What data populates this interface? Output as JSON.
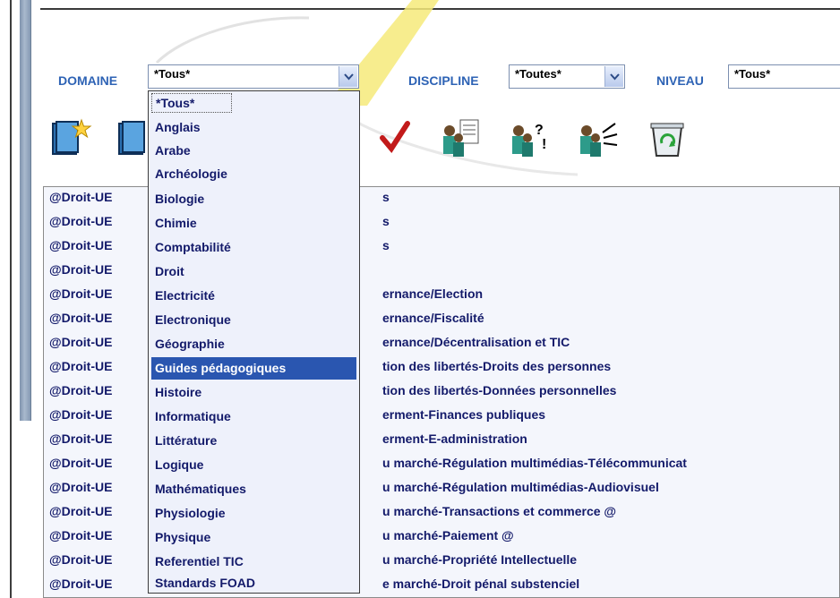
{
  "filters": {
    "domaine": {
      "label": "DOMAINE",
      "value": "*Tous*"
    },
    "discipline": {
      "label": "DISCIPLINE",
      "value": "*Toutes*"
    },
    "niveau": {
      "label": "NIVEAU",
      "value": "*Tous*"
    }
  },
  "toolbar": {
    "icons": [
      "new-star-book-icon",
      "book-icon",
      "checkmark-icon",
      "people-document-icon",
      "people-question-icon",
      "people-broadcast-icon",
      "recycle-bin-icon"
    ]
  },
  "dropdown": {
    "options": [
      "*Tous*",
      "Anglais",
      "Arabe",
      "Archéologie",
      "Biologie",
      "Chimie",
      "Comptabilité",
      "Droit",
      "Electricité",
      "Electronique",
      "Géographie",
      "Guides pédagogiques",
      "Histoire",
      "Informatique",
      "Littérature",
      "Logique",
      "Mathématiques",
      "Physiologie",
      "Physique",
      "Referentiel TIC",
      "Standards FOAD"
    ],
    "selected_index": 11
  },
  "table": {
    "rows": [
      {
        "left": "@Droit-UE",
        "right": "s"
      },
      {
        "left": "@Droit-UE",
        "right": "s"
      },
      {
        "left": "@Droit-UE",
        "right": "s"
      },
      {
        "left": "@Droit-UE",
        "right": ""
      },
      {
        "left": "@Droit-UE",
        "right": "ernance/Election"
      },
      {
        "left": "@Droit-UE",
        "right": "ernance/Fiscalité"
      },
      {
        "left": "@Droit-UE",
        "right": "ernance/Décentralisation et TIC"
      },
      {
        "left": "@Droit-UE",
        "right": "tion des libertés-Droits des personnes"
      },
      {
        "left": "@Droit-UE",
        "right": "tion des libertés-Données personnelles"
      },
      {
        "left": "@Droit-UE",
        "right": "erment-Finances publiques"
      },
      {
        "left": "@Droit-UE",
        "right": "erment-E-administration"
      },
      {
        "left": "@Droit-UE",
        "right": "u marché-Régulation multimédias-Télécommunicat"
      },
      {
        "left": "@Droit-UE",
        "right": "u marché-Régulation multimédias-Audiovisuel"
      },
      {
        "left": "@Droit-UE",
        "right": "u marché-Transactions et commerce @"
      },
      {
        "left": "@Droit-UE",
        "right": "u marché-Paiement @"
      },
      {
        "left": "@Droit-UE",
        "right": "u marché-Propriété Intellectuelle"
      },
      {
        "left": "@Droit-UE",
        "right": "e marché-Droit pénal substenciel"
      }
    ]
  }
}
